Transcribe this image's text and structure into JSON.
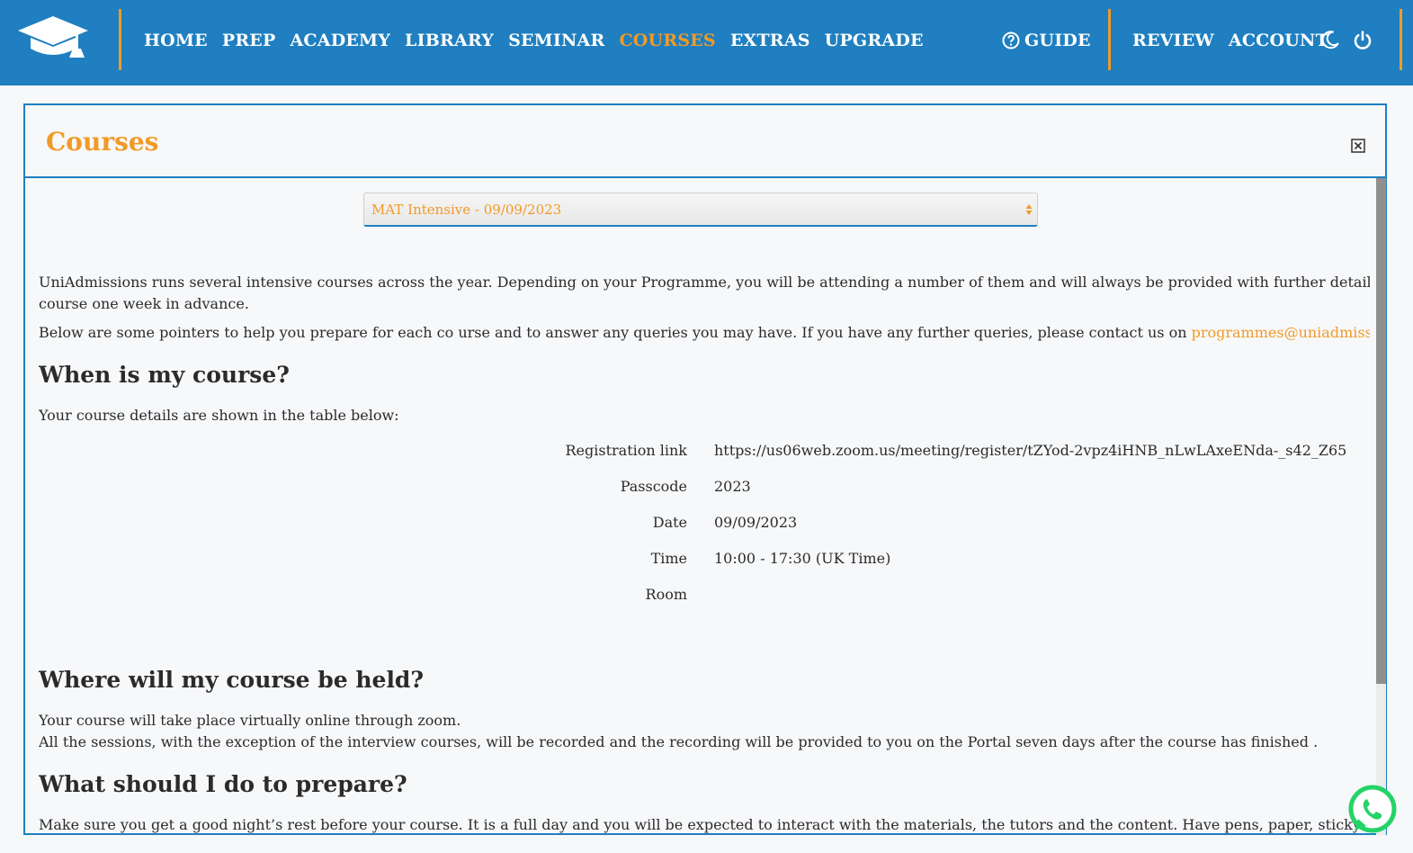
{
  "nav": {
    "items": [
      {
        "label": "HOME"
      },
      {
        "label": "PREP"
      },
      {
        "label": "ACADEMY"
      },
      {
        "label": "LIBRARY"
      },
      {
        "label": "SEMINAR"
      },
      {
        "label": "COURSES",
        "active": true
      },
      {
        "label": "EXTRAS"
      },
      {
        "label": "UPGRADE"
      }
    ],
    "guide_label": "GUIDE",
    "right_items": [
      {
        "label": "REVIEW"
      },
      {
        "label": "ACCOUNT"
      }
    ],
    "icons": [
      "graduation-cap-icon",
      "help-circle-icon",
      "moon-icon",
      "power-icon"
    ]
  },
  "colors": {
    "primary": "#1f7fc0",
    "accent": "#f19a26",
    "text": "#2b2b2b",
    "background": "#f7f8fa",
    "whatsapp": "#25d366"
  },
  "panel": {
    "title": "Courses",
    "close_icon": "close-box-icon"
  },
  "course_select": {
    "value": "MAT Intensive - 09/09/2023"
  },
  "intro": {
    "line1": "UniAdmissions runs several intensive courses across the year. Depending on your Programme, you will be attending a number of them and will always be provided with further details of the",
    "line2": "course one week in advance.",
    "line3": "Below are some pointers to help you prepare for each co urse and to answer any queries you may have. If you have any further queries, please contact us on",
    "email": "programmes@uniadmissions.co.uk"
  },
  "when": {
    "heading": "When is my course?",
    "text": "Your course details are shown in the table below:",
    "details": [
      {
        "label": "Registration link",
        "value": "https://us06web.zoom.us/meeting/register/tZYod-2vpz4iHNB_nLwLAxeENda-_s42_Z65",
        "is_link": true
      },
      {
        "label": "Passcode",
        "value": "2023"
      },
      {
        "label": "Date",
        "value": "09/09/2023"
      },
      {
        "label": "Time",
        "value": "10:00 - 17:30 (UK Time)"
      },
      {
        "label": "Room",
        "value": ""
      }
    ]
  },
  "where": {
    "heading": "Where will my course be held?",
    "line1": "Your course will take place virtually online through zoom.",
    "line2": "All the sessions, with the exception of the interview courses, will be recorded and the recording will be provided to you on the Portal seven days after the course has finished ."
  },
  "prepare": {
    "heading": "What should I do to prepare?",
    "line1": "Make sure you get a good night’s rest before your course. It is a full day and you will be expected to interact with the materials, the tutors and the content. Have pens, paper, sticky notes in front"
  },
  "whatsapp_icon": "whatsapp-icon"
}
